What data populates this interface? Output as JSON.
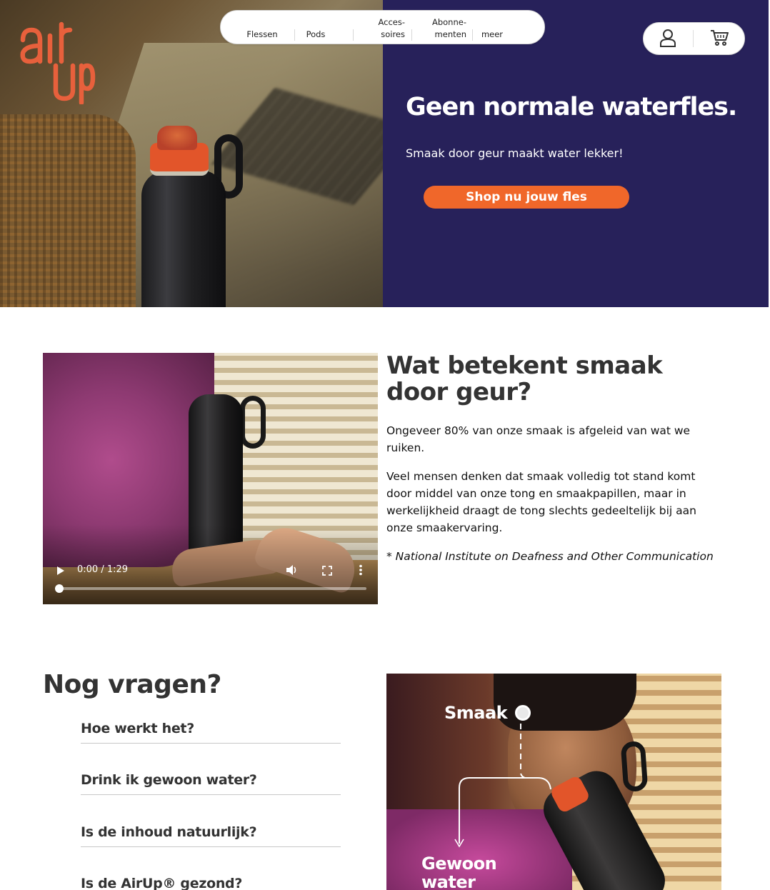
{
  "brand": {
    "logo_text": "air up",
    "logo_color": "#e8603c"
  },
  "nav": {
    "items": [
      {
        "label": "Flessen"
      },
      {
        "label": "Pods"
      },
      {
        "line1": "Acces-",
        "line2": "soires"
      },
      {
        "line1": "Abonne-",
        "line2": "menten"
      },
      {
        "label": "meer"
      }
    ]
  },
  "header_icons": {
    "account": "user-icon",
    "cart": "cart-icon"
  },
  "hero": {
    "title": "Geen normale waterfles.",
    "subtitle": "Smaak door geur maakt water lekker!",
    "cta": "Shop nu jouw fles",
    "panel_color": "#27215a",
    "cta_color": "#f0672a"
  },
  "video": {
    "time": "0:00 / 1:29",
    "progress": 0,
    "controls": [
      "play-icon",
      "volume-icon",
      "fullscreen-icon",
      "more-vertical-icon"
    ]
  },
  "info": {
    "title": "Wat betekent smaak door geur?",
    "paragraph1": "Ongeveer 80% van onze smaak is afgeleid van wat we ruiken.",
    "paragraph2": "Veel mensen denken dat smaak volledig tot stand komt door middel van onze tong en smaakpapillen, maar in werkelijkheid draagt de tong slechts gedeeltelijk bij aan onze smaakervaring.",
    "source": "* National Institute on Deafness and Other Communication"
  },
  "faq": {
    "title": "Nog vragen?",
    "questions": [
      "Hoe werkt het?",
      "Drink ik gewoon water?",
      "Is de inhoud natuurlijk?",
      "Is de AirUp® gezond?"
    ]
  },
  "illustration": {
    "label_top": "Smaak",
    "label_bottom": "Gewoon water"
  }
}
